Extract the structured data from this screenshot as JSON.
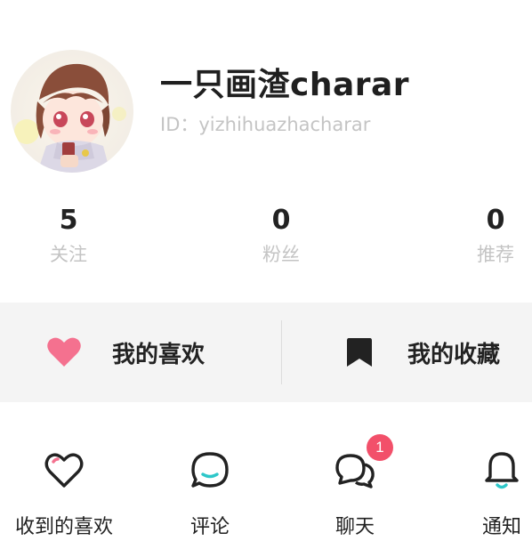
{
  "profile": {
    "username": "一只画渣charar",
    "id_label": "ID：",
    "id_value": "yizhihuazhacharar"
  },
  "stats": [
    {
      "value": "5",
      "label": "关注"
    },
    {
      "value": "0",
      "label": "粉丝"
    },
    {
      "value": "0",
      "label": "推荐"
    }
  ],
  "actions": {
    "likes_label": "我的喜欢",
    "favorites_label": "我的收藏"
  },
  "menu": [
    {
      "label": "收到的喜欢",
      "icon": "heart-outline-icon"
    },
    {
      "label": "评论",
      "icon": "comment-bubble-icon"
    },
    {
      "label": "聊天",
      "icon": "chat-bubbles-icon",
      "badge": "1"
    },
    {
      "label": "通知",
      "icon": "bell-icon"
    }
  ],
  "colors": {
    "accent_pink": "#f4718f",
    "accent_teal": "#2ec7c9",
    "badge_red": "#f2506a",
    "muted_text": "#c4c4c4"
  }
}
